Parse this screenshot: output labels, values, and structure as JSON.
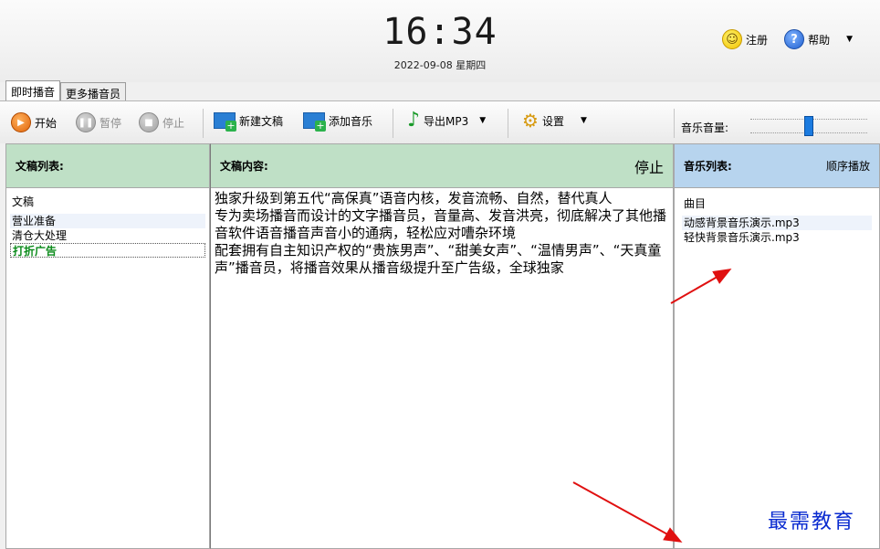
{
  "header": {
    "clock": "16:34",
    "date": "2022-09-08 星期四",
    "register_label": "注册",
    "help_label": "帮助"
  },
  "tabs": [
    {
      "label": "即时播音",
      "active": true
    },
    {
      "label": "更多播音员",
      "active": false
    }
  ],
  "toolbar": {
    "play_label": "开始",
    "pause_label": "暂停",
    "stop_label": "停止",
    "new_doc_label": "新建文稿",
    "add_music_label": "添加音乐",
    "export_label": "导出MP3",
    "settings_label": "设置",
    "volume_label": "音乐音量:",
    "volume_level": 0.5
  },
  "doc_panel": {
    "title": "文稿列表:",
    "header": "文稿",
    "items": [
      "营业准备",
      "清仓大处理",
      "打折广告"
    ],
    "selected_index": 2
  },
  "content_panel": {
    "title": "文稿内容:",
    "status": "停止",
    "paragraphs": [
      "独家升级到第五代“高保真”语音内核，发音流畅、自然，替代真人",
      "专为卖场播音而设计的文字播音员，音量高、发音洪亮，彻底解决了其他播音软件语音播音声音小的通病，轻松应对嘈杂环境",
      "配套拥有自主知识产权的“贵族男声”、“甜美女声”、“温情男声”、“天真童声”播音员，将播音效果从播音级提升至广告级，全球独家"
    ]
  },
  "music_panel": {
    "title": "音乐列表:",
    "mode": "顺序播放",
    "header": "曲目",
    "items": [
      "动感背景音乐演示.mp3",
      "轻快背景音乐演示.mp3"
    ]
  },
  "watermark": "最需教育",
  "colors": {
    "doc_header_bg": "#bfe0c6",
    "music_header_bg": "#b7d4ee",
    "selected_text": "#0a8a1a",
    "arrow": "#e01010",
    "watermark": "#0a2bd0"
  }
}
